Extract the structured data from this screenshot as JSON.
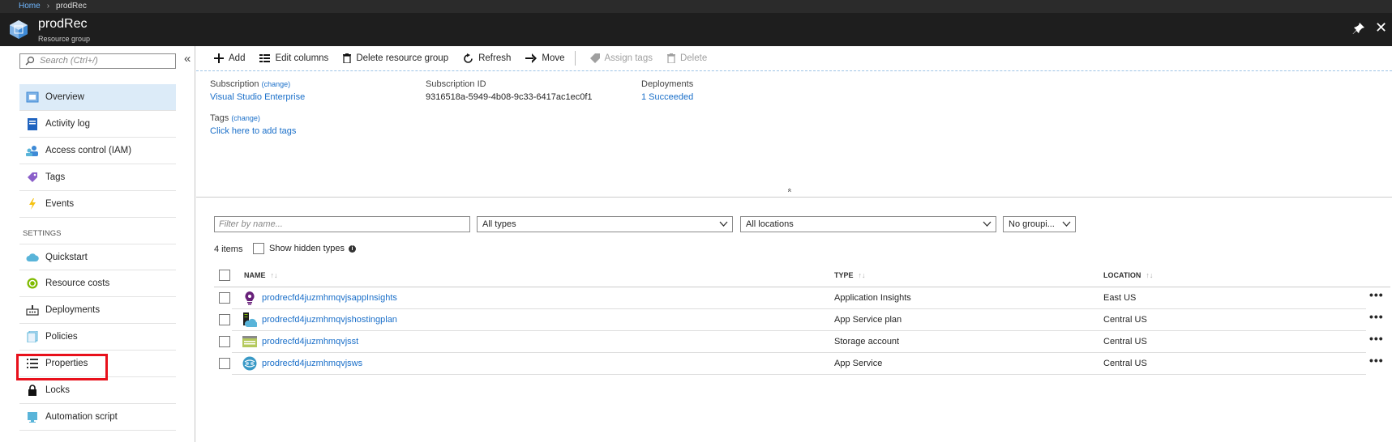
{
  "breadcrumb": {
    "home": "Home",
    "current": "prodRec"
  },
  "header": {
    "title": "prodRec",
    "subtitle": "Resource group"
  },
  "sidebar": {
    "search_placeholder": "Search (Ctrl+/)",
    "collapse_glyph": "«",
    "items": [
      {
        "label": "Overview",
        "icon": "overview-icon"
      },
      {
        "label": "Activity log",
        "icon": "activity-log-icon"
      },
      {
        "label": "Access control (IAM)",
        "icon": "iam-icon"
      },
      {
        "label": "Tags",
        "icon": "tag-icon"
      },
      {
        "label": "Events",
        "icon": "lightning-icon"
      }
    ],
    "settings_label": "SETTINGS",
    "settings_items": [
      {
        "label": "Quickstart",
        "icon": "cloud-icon"
      },
      {
        "label": "Resource costs",
        "icon": "cost-icon"
      },
      {
        "label": "Deployments",
        "icon": "deployments-icon"
      },
      {
        "label": "Policies",
        "icon": "policy-icon"
      },
      {
        "label": "Properties",
        "icon": "properties-icon"
      },
      {
        "label": "Locks",
        "icon": "lock-icon"
      },
      {
        "label": "Automation script",
        "icon": "automation-icon"
      }
    ]
  },
  "toolbar": {
    "add": "Add",
    "edit_columns": "Edit columns",
    "delete_group": "Delete resource group",
    "refresh": "Refresh",
    "move": "Move",
    "assign_tags": "Assign tags",
    "delete": "Delete"
  },
  "essentials": {
    "subscription_label": "Subscription",
    "change": "(change)",
    "subscription_value": "Visual Studio Enterprise",
    "subscription_id_label": "Subscription ID",
    "subscription_id_value": "9316518a-5949-4b08-9c33-6417ac1ec0f1",
    "deployments_label": "Deployments",
    "deployments_value": "1 Succeeded",
    "tags_label": "Tags",
    "tags_value": "Click here to add tags",
    "collapse_glyph": "«"
  },
  "filters": {
    "name_placeholder": "Filter by name...",
    "types": "All types",
    "locations": "All locations",
    "grouping": "No groupi..."
  },
  "list": {
    "count": "4 items",
    "show_hidden": "Show hidden types",
    "columns": {
      "name": "NAME",
      "type": "TYPE",
      "location": "LOCATION"
    },
    "sort_glyph": "↑↓",
    "more_glyph": "•••",
    "rows": [
      {
        "name": "prodrecfd4juzmhmqvjsappInsights",
        "type": "Application Insights",
        "location": "East US",
        "icon": "app-insights-icon"
      },
      {
        "name": "prodrecfd4juzmhmqvjshostingplan",
        "type": "App Service plan",
        "location": "Central US",
        "icon": "app-service-plan-icon"
      },
      {
        "name": "prodrecfd4juzmhmqvjsst",
        "type": "Storage account",
        "location": "Central US",
        "icon": "storage-account-icon"
      },
      {
        "name": "prodrecfd4juzmhmqvjsws",
        "type": "App Service",
        "location": "Central US",
        "icon": "app-service-icon"
      }
    ]
  }
}
